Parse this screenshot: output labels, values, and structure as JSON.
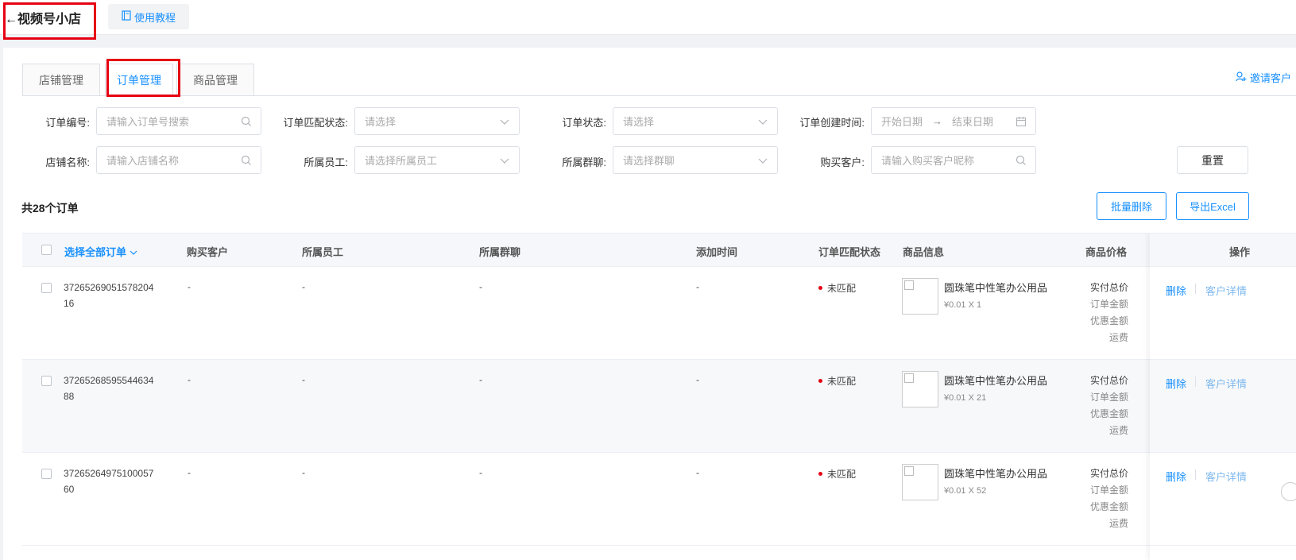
{
  "header": {
    "back_arrow": "←",
    "title": "视频号小店",
    "tutorial_label": "使用教程"
  },
  "tabs": [
    {
      "label": "店铺管理"
    },
    {
      "label": "订单管理"
    },
    {
      "label": "商品管理"
    }
  ],
  "invite_label": "邀请客户",
  "filters": {
    "order_no": {
      "label": "订单编号:",
      "placeholder": "请输入订单号搜索"
    },
    "match_status": {
      "label": "订单匹配状态:",
      "placeholder": "请选择"
    },
    "order_status": {
      "label": "订单状态:",
      "placeholder": "请选择"
    },
    "create_time": {
      "label": "订单创建时间:",
      "start": "开始日期",
      "arrow": "→",
      "end": "结束日期"
    },
    "shop_name": {
      "label": "店铺名称:",
      "placeholder": "请输入店铺名称"
    },
    "staff": {
      "label": "所属员工:",
      "placeholder": "请选择所属员工"
    },
    "group": {
      "label": "所属群聊:",
      "placeholder": "请选择群聊"
    },
    "customer": {
      "label": "购买客户:",
      "placeholder": "请输入购买客户昵称"
    }
  },
  "reset_label": "重置",
  "summary": "共28个订单",
  "buttons": {
    "batch_delete": "批量删除",
    "export": "导出Excel"
  },
  "table": {
    "headers": {
      "select_all": "选择全部订单",
      "customer": "购买客户",
      "staff": "所属员工",
      "group": "所属群聊",
      "add_time": "添加时间",
      "match_status": "订单匹配状态",
      "product": "商品信息",
      "price": "商品价格",
      "ops": "操作"
    },
    "rows": [
      {
        "order_no": "3726526905157820416",
        "customer": "-",
        "staff": "-",
        "group": "-",
        "add_time": "-",
        "status": "未匹配",
        "product_name": "圆珠笔中性笔办公用品",
        "product_qty": "¥0.01 X 1",
        "price_lines": [
          "实付总价",
          "订单金额",
          "优惠金额",
          "运费"
        ]
      },
      {
        "order_no": "3726526859554463488",
        "customer": "-",
        "staff": "-",
        "group": "-",
        "add_time": "-",
        "status": "未匹配",
        "product_name": "圆珠笔中性笔办公用品",
        "product_qty": "¥0.01 X 21",
        "price_lines": [
          "实付总价",
          "订单金额",
          "优惠金额",
          "运费"
        ]
      },
      {
        "order_no": "3726526497510005760",
        "customer": "-",
        "staff": "-",
        "group": "-",
        "add_time": "-",
        "status": "未匹配",
        "product_name": "圆珠笔中性笔办公用品",
        "product_qty": "¥0.01 X 52",
        "price_lines": [
          "实付总价",
          "订单金额",
          "优惠金额",
          "运费"
        ]
      }
    ],
    "ops": {
      "delete": "删除",
      "detail": "客户详情"
    }
  },
  "colors": {
    "accent": "#1890ff",
    "highlight": "#e60012",
    "status_dot": "#e60012"
  }
}
